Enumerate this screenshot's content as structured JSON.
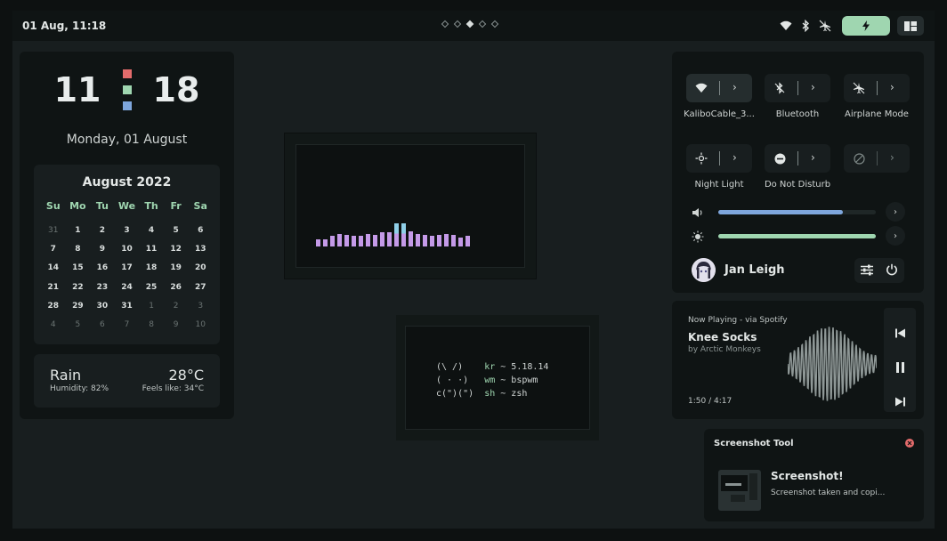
{
  "topbar": {
    "datetime": "01 Aug, 11:18",
    "workspaces": [
      false,
      false,
      true,
      false,
      false
    ]
  },
  "clock": {
    "hour": "11",
    "minute": "18",
    "date": "Monday, 01 August",
    "dot_colors": [
      "#e36b6b",
      "#9fd6b0",
      "#7ea6dc"
    ]
  },
  "calendar": {
    "title": "August 2022",
    "weekdays": [
      "Su",
      "Mo",
      "Tu",
      "We",
      "Th",
      "Fr",
      "Sa"
    ],
    "days": [
      {
        "d": "31",
        "m": true
      },
      {
        "d": "1"
      },
      {
        "d": "2"
      },
      {
        "d": "3"
      },
      {
        "d": "4"
      },
      {
        "d": "5"
      },
      {
        "d": "6"
      },
      {
        "d": "7"
      },
      {
        "d": "8"
      },
      {
        "d": "9"
      },
      {
        "d": "10"
      },
      {
        "d": "11"
      },
      {
        "d": "12"
      },
      {
        "d": "13"
      },
      {
        "d": "14"
      },
      {
        "d": "15"
      },
      {
        "d": "16"
      },
      {
        "d": "17"
      },
      {
        "d": "18"
      },
      {
        "d": "19"
      },
      {
        "d": "20"
      },
      {
        "d": "21"
      },
      {
        "d": "22"
      },
      {
        "d": "23"
      },
      {
        "d": "24"
      },
      {
        "d": "25"
      },
      {
        "d": "26"
      },
      {
        "d": "27"
      },
      {
        "d": "28"
      },
      {
        "d": "29"
      },
      {
        "d": "30"
      },
      {
        "d": "31"
      },
      {
        "d": "1",
        "m": true
      },
      {
        "d": "2",
        "m": true
      },
      {
        "d": "3",
        "m": true
      },
      {
        "d": "4",
        "m": true
      },
      {
        "d": "5",
        "m": true
      },
      {
        "d": "6",
        "m": true
      },
      {
        "d": "7",
        "m": true
      },
      {
        "d": "8",
        "m": true
      },
      {
        "d": "9",
        "m": true
      },
      {
        "d": "10",
        "m": true
      }
    ]
  },
  "weather": {
    "condition": "Rain",
    "temperature": "28°C",
    "humidity": "Humidity: 82%",
    "feels_like": "Feels like: 34°C"
  },
  "visualizer": {
    "bar_levels": [
      0.3,
      0.3,
      0.45,
      0.55,
      0.5,
      0.45,
      0.45,
      0.55,
      0.5,
      0.6,
      0.6,
      1.0,
      1.0,
      0.65,
      0.55,
      0.5,
      0.45,
      0.5,
      0.55,
      0.5,
      0.4,
      0.45
    ],
    "bar_color": "#c49ae8",
    "highlight_color": "#8fd0e8"
  },
  "terminal": {
    "art": [
      "(\\ /)",
      "( · ·)",
      "c(\")(\")"
    ],
    "keys": [
      "kr",
      "wm",
      "sh"
    ],
    "values": [
      " ~ 5.18.14",
      " ~ bspwm",
      " ~ zsh"
    ]
  },
  "control_center": {
    "toggles": [
      {
        "label": "KaliboCable_3...",
        "icon": "wifi-icon",
        "active": true
      },
      {
        "label": "Bluetooth",
        "icon": "bluetooth-icon",
        "active": false
      },
      {
        "label": "Airplane Mode",
        "icon": "airplane-icon",
        "active": false
      },
      {
        "label": "Night Light",
        "icon": "night-light-icon",
        "active": false
      },
      {
        "label": "Do Not Disturb",
        "icon": "dnd-icon",
        "active": false
      },
      {
        "label": "",
        "icon": "disabled-icon",
        "active": false
      }
    ],
    "volume_level": 0.79,
    "brightness_level": 1.0,
    "volume_color": "#7ea6dc",
    "brightness_color": "#9fd6b0",
    "user_name": "Jan Leigh"
  },
  "music": {
    "source": "Now Playing - via Spotify",
    "title": "Knee Socks",
    "artist": "by Arctic Monkeys",
    "time": "1:50 / 4:17"
  },
  "notification": {
    "app": "Screenshot Tool",
    "title": "Screenshot!",
    "body": "Screenshot taken and copi..."
  }
}
